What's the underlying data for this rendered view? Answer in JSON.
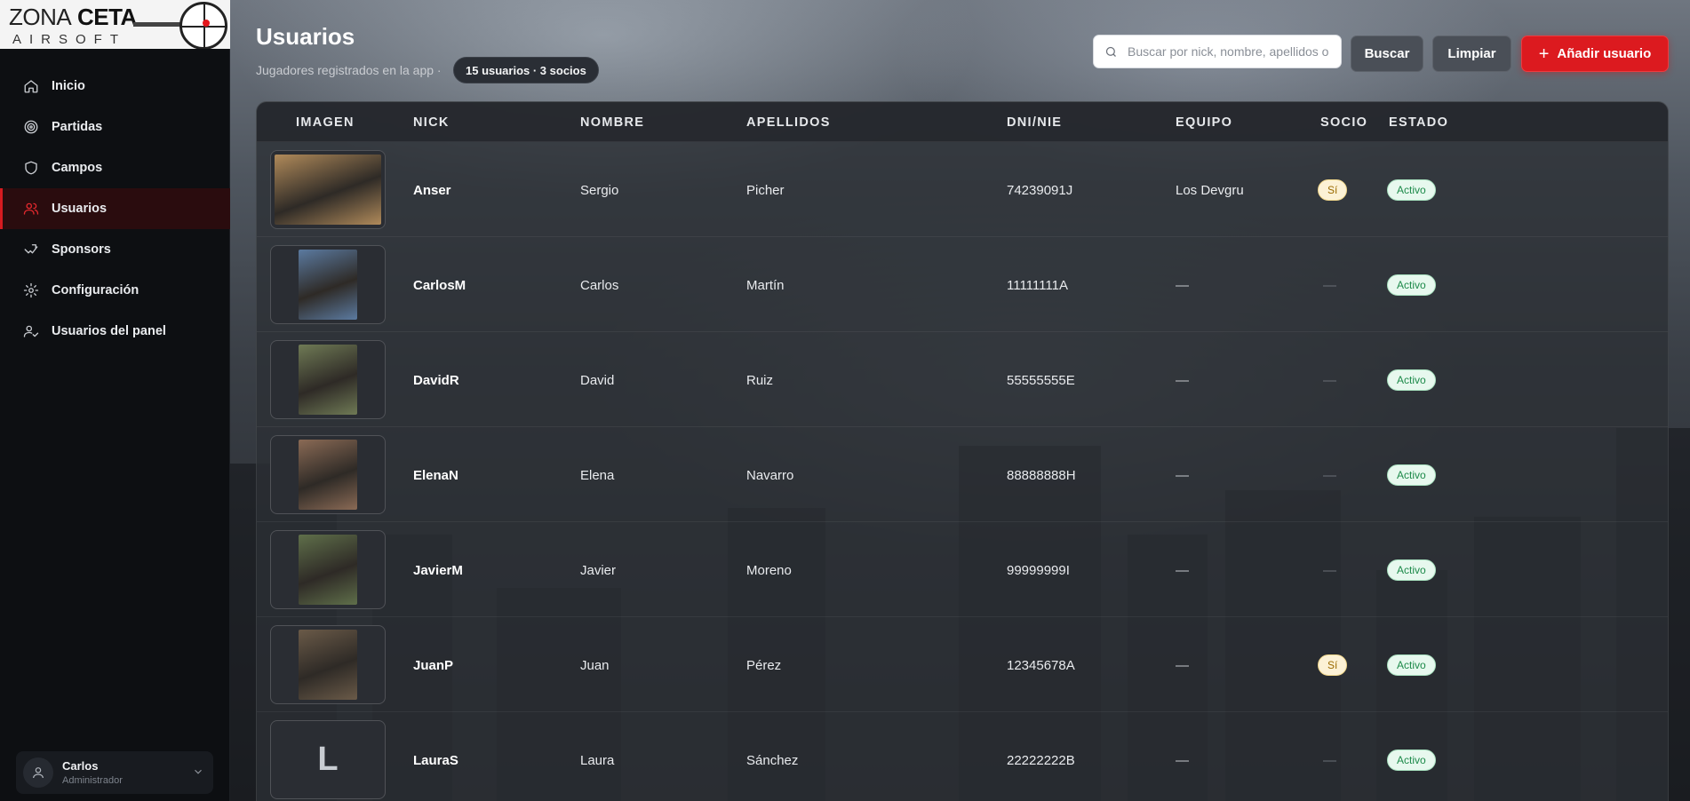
{
  "brand": {
    "line1_bold": "ZONA",
    "line1_second": "CETA",
    "line2": "AIRSOFT"
  },
  "nav": [
    {
      "label": "Inicio",
      "icon": "home-icon",
      "active": false
    },
    {
      "label": "Partidas",
      "icon": "target-icon",
      "active": false
    },
    {
      "label": "Campos",
      "icon": "shield-icon",
      "active": false
    },
    {
      "label": "Usuarios",
      "icon": "users-icon",
      "active": true
    },
    {
      "label": "Sponsors",
      "icon": "handshake-icon",
      "active": false
    },
    {
      "label": "Configuración",
      "icon": "gear-icon",
      "active": false
    },
    {
      "label": "Usuarios del panel",
      "icon": "user-check-icon",
      "active": false
    }
  ],
  "current_user": {
    "name": "Carlos",
    "role": "Administrador"
  },
  "header": {
    "title": "Usuarios",
    "subtitle": "Jugadores registrados en la app ·",
    "pill": "15 usuarios · 3 socios"
  },
  "search": {
    "placeholder": "Buscar por nick, nombre, apellidos o",
    "value": ""
  },
  "buttons": {
    "search": "Buscar",
    "clear": "Limpiar",
    "add": "Añadir usuario",
    "add_symbol": "+"
  },
  "table": {
    "columns": [
      "IMAGEN",
      "NICK",
      "NOMBRE",
      "APELLIDOS",
      "DNI/NIE",
      "EQUIPO",
      "SOCIO",
      "ESTADO"
    ],
    "rows": [
      {
        "nick": "Anser",
        "nombre": "Sergio",
        "apellidos": "Picher",
        "dni": "74239091J",
        "equipo": "Los Devgru",
        "socio": "Sí",
        "estado": "Activo",
        "image": "photo",
        "tone": "#b08a5a"
      },
      {
        "nick": "CarlosM",
        "nombre": "Carlos",
        "apellidos": "Martín",
        "dni": "11111111A",
        "equipo": "—",
        "socio": "—",
        "estado": "Activo",
        "image": "photo",
        "tone": "#5b7aa0"
      },
      {
        "nick": "DavidR",
        "nombre": "David",
        "apellidos": "Ruiz",
        "dni": "55555555E",
        "equipo": "—",
        "socio": "—",
        "estado": "Activo",
        "image": "photo",
        "tone": "#6f7a55"
      },
      {
        "nick": "ElenaN",
        "nombre": "Elena",
        "apellidos": "Navarro",
        "dni": "88888888H",
        "equipo": "—",
        "socio": "—",
        "estado": "Activo",
        "image": "photo",
        "tone": "#8a6a55"
      },
      {
        "nick": "JavierM",
        "nombre": "Javier",
        "apellidos": "Moreno",
        "dni": "99999999I",
        "equipo": "—",
        "socio": "—",
        "estado": "Activo",
        "image": "photo",
        "tone": "#5f6f4a"
      },
      {
        "nick": "JuanP",
        "nombre": "Juan",
        "apellidos": "Pérez",
        "dni": "12345678A",
        "equipo": "—",
        "socio": "Sí",
        "estado": "Activo",
        "image": "photo",
        "tone": "#6a5a48"
      },
      {
        "nick": "LauraS",
        "nombre": "Laura",
        "apellidos": "Sánchez",
        "dni": "22222222B",
        "equipo": "—",
        "socio": "—",
        "estado": "Activo",
        "image": "letter",
        "letter": "L"
      }
    ]
  }
}
